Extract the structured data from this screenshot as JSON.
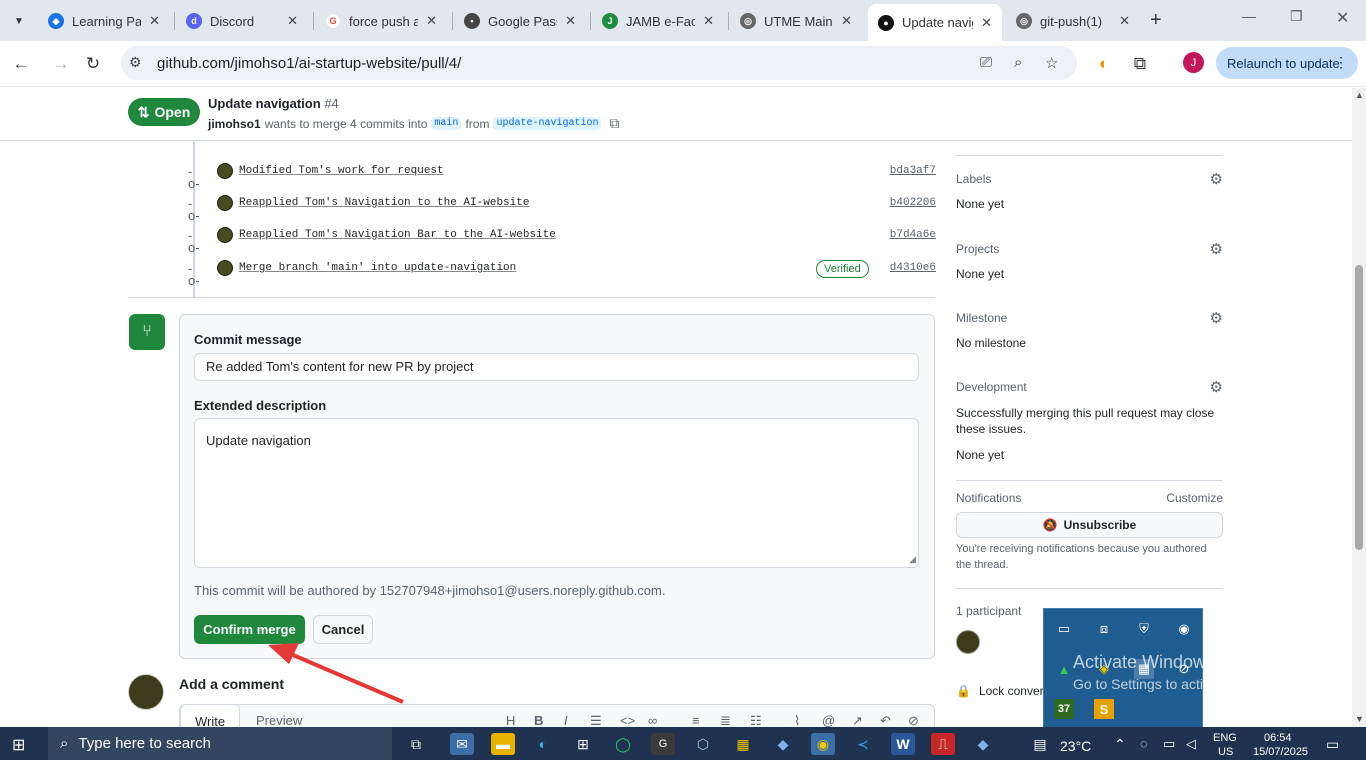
{
  "browser": {
    "tabs": [
      {
        "title": "Learning Pat",
        "favicon": "learning-icon",
        "color": "#1a73e8"
      },
      {
        "title": "Discord",
        "favicon": "discord-icon",
        "color": "#5865f2"
      },
      {
        "title": "force push a",
        "favicon": "google-icon",
        "color": "#ea4335"
      },
      {
        "title": "Google Pass",
        "favicon": "password-key-icon",
        "color": "#444444"
      },
      {
        "title": "JAMB e-Facil",
        "favicon": "jamb-icon",
        "color": "#1e8e3e"
      },
      {
        "title": "UTME Main",
        "favicon": "globe-icon",
        "color": "#555555"
      },
      {
        "title": "Update navig",
        "favicon": "github-icon",
        "color": "#111111"
      },
      {
        "title": "git-push(1)",
        "favicon": "globe-icon",
        "color": "#555555"
      }
    ],
    "url": "github.com/jimohso1/ai-startup-website/pull/4/",
    "profile_initial": "J",
    "relaunch_label": "Relaunch to update"
  },
  "pr": {
    "status": "Open",
    "title": "Update navigation",
    "number": "#4",
    "author": "jimohso1",
    "meta_text": "wants to merge 4 commits into",
    "base_branch": "main",
    "from_text": "from",
    "head_branch": "update-navigation"
  },
  "commits": [
    {
      "message": "Modified Tom's work for request",
      "sha": "bda3af7",
      "verified": ""
    },
    {
      "message": "Reapplied Tom's Navigation to the AI-website",
      "sha": "b402206",
      "verified": ""
    },
    {
      "message": "Reapplied Tom's Navigation Bar to the AI-website",
      "sha": "b7d4a6e",
      "verified": ""
    },
    {
      "message": "Merge branch 'main' into update-navigation",
      "sha": "d4310e6",
      "verified": "Verified"
    }
  ],
  "merge": {
    "commit_message_label": "Commit message",
    "commit_message_value": "Re added Tom's content for new PR by project",
    "extended_label": "Extended description",
    "extended_value": "Update navigation",
    "author_note": "This commit will be authored by 152707948+jimohso1@users.noreply.github.com.",
    "confirm_label": "Confirm merge",
    "cancel_label": "Cancel"
  },
  "comment": {
    "title": "Add a comment",
    "tab_write": "Write",
    "tab_preview": "Preview"
  },
  "sidebar": {
    "labels": {
      "heading": "Labels",
      "value": "None yet"
    },
    "projects": {
      "heading": "Projects",
      "value": "None yet"
    },
    "milestone": {
      "heading": "Milestone",
      "value": "No milestone"
    },
    "development": {
      "heading": "Development",
      "note": "Successfully merging this pull request may close these issues.",
      "value": "None yet"
    },
    "notifications": {
      "heading": "Notifications",
      "customize": "Customize",
      "unsubscribe": "Unsubscribe",
      "note": "You're receiving notifications because you authored the thread."
    },
    "participants": {
      "heading": "1 participant"
    },
    "lock": {
      "label": "Lock conversa"
    }
  },
  "windows": {
    "watermark_title": "Activate Windows",
    "watermark_sub": "Go to Settings to activate Windows.",
    "tray_badge": "37",
    "search_placeholder": "Type here to search",
    "temperature": "23°C",
    "lang_top": "ENG",
    "lang_bottom": "US",
    "time": "06:54",
    "date": "15/07/2025"
  },
  "colors": {
    "accent_green": "#1f883d",
    "arrow_red": "#e53935",
    "taskbar": "#1f3350"
  }
}
